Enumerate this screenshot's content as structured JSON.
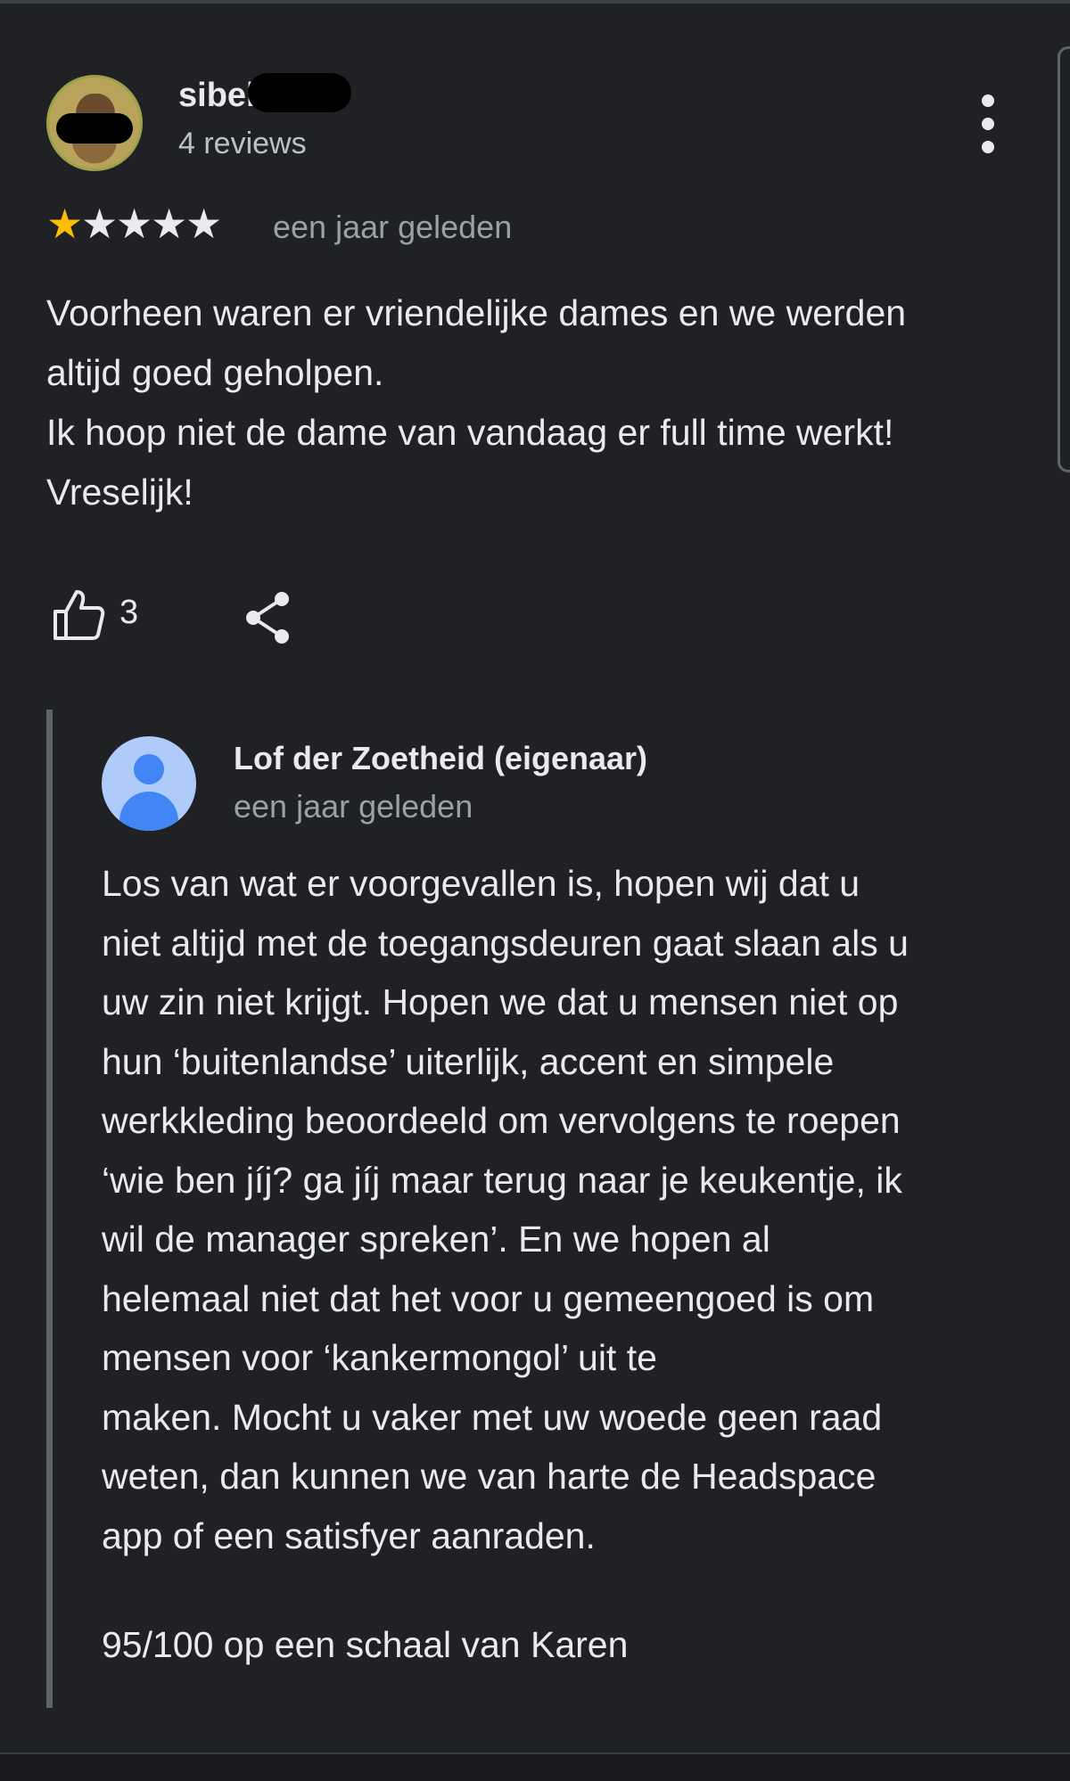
{
  "review": {
    "author_name": "sibel",
    "review_count": "4 reviews",
    "rating": 1,
    "max_rating": 5,
    "time": "een jaar geleden",
    "text_lines": [
      "Voorheen waren er vriendelijke dames en we werden",
      "altijd goed geholpen.",
      "Ik hoop niet de dame van vandaag er full time werkt!",
      "Vreselijk!"
    ],
    "likes": "3",
    "icons": {
      "more": "more-vert-icon",
      "like": "thumbs-up-icon",
      "share": "share-icon",
      "star_filled": "★",
      "star_empty": "★"
    },
    "colors": {
      "background": "#202124",
      "star_filled": "#fbbc04",
      "star_empty": "#e8eaed",
      "secondary_text": "#9aa0a6"
    }
  },
  "reply": {
    "owner_name": "Lof der Zoetheid (eigenaar)",
    "time": "een jaar geleden",
    "text_lines": [
      "Los van wat er voorgevallen is, hopen wij dat u",
      "niet altijd met de toegangsdeuren gaat slaan als u",
      "uw zin niet krijgt. Hopen we dat u mensen niet op",
      "hun ‘buitenlandse’ uiterlijk, accent en simpele",
      "werkkleding beoordeeld om vervolgens te roepen",
      "‘wie ben jíj? ga jíj maar terug naar je keukentje, ik",
      "wil de manager spreken’. En we hopen al",
      "helemaal niet dat het voor u gemeengoed is om",
      "mensen voor ‘kankermongol’ uit te",
      "maken. Mocht u vaker met uw woede geen raad",
      "weten, dan kunnen we van harte de Headspace",
      "app of een satisfyer aanraden."
    ],
    "footer_line": "95/100 op een schaal van Karen",
    "avatar_color": "#4285f4"
  }
}
